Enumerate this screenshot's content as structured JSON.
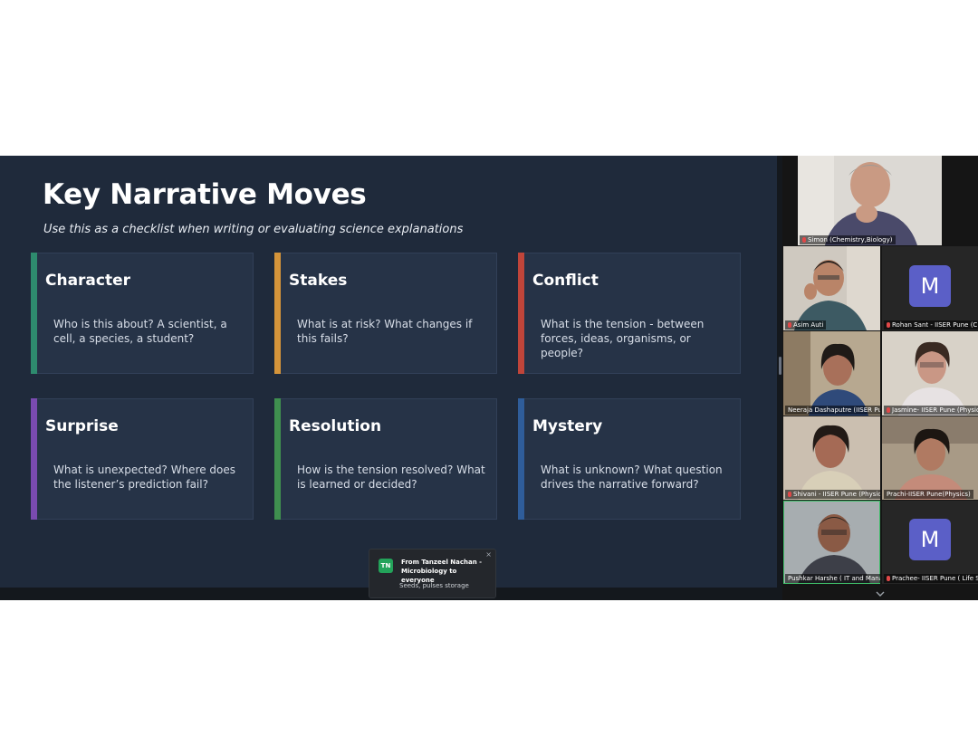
{
  "slide": {
    "title": "Key Narrative Moves",
    "subtitle": "Use this as a checklist when writing or evaluating science explanations",
    "cards": [
      {
        "title": "Character",
        "desc": "Who is this about? A scientist, a cell, a species, a student?",
        "color": "#2e8b6e"
      },
      {
        "title": "Stakes",
        "desc": "What is at risk? What changes if this fails?",
        "color": "#d4943a"
      },
      {
        "title": "Conflict",
        "desc": "What is the tension - between forces, ideas, organisms, or people?",
        "color": "#c0453a"
      },
      {
        "title": "Surprise",
        "desc": "What is unexpected? Where does the listener’s prediction fail?",
        "color": "#7a4bb0"
      },
      {
        "title": "Resolution",
        "desc": "How is the tension resolved? What is learned or decided?",
        "color": "#3f8f4f"
      },
      {
        "title": "Mystery",
        "desc": "What is unknown? What question drives the narrative forward?",
        "color": "#2f5d9a"
      }
    ]
  },
  "participants": [
    {
      "name": "Simon (Chemistry,Biology)",
      "type": "video"
    },
    {
      "name": "Asim Auti",
      "type": "video"
    },
    {
      "name": "Rohan Sant - IISER Pune (C...",
      "type": "avatar",
      "initial": "M"
    },
    {
      "name": "Neeraja Dashaputre (IISER Pu...",
      "type": "video"
    },
    {
      "name": "Jasmine- IISER Pune (Physics)",
      "type": "video"
    },
    {
      "name": "Shivani - IISER Pune (Physics)",
      "type": "video"
    },
    {
      "name": "Prachi-IISER Pune(Physics)",
      "type": "video"
    },
    {
      "name": "Pushkar Harshe ( IT and Mana...",
      "type": "video"
    },
    {
      "name": "Prachee- IISER Pune ( Life S...",
      "type": "avatar",
      "initial": "M"
    }
  ],
  "chat_toast": {
    "initials": "TN",
    "from": "From Tanzeel Nachan - Microbiology to everyone",
    "message": "Seeds, pulses storage",
    "close": "×"
  },
  "colors": {
    "active_speaker_border": "#3fbf6a",
    "avatar_bg": "#5b5fc7"
  }
}
